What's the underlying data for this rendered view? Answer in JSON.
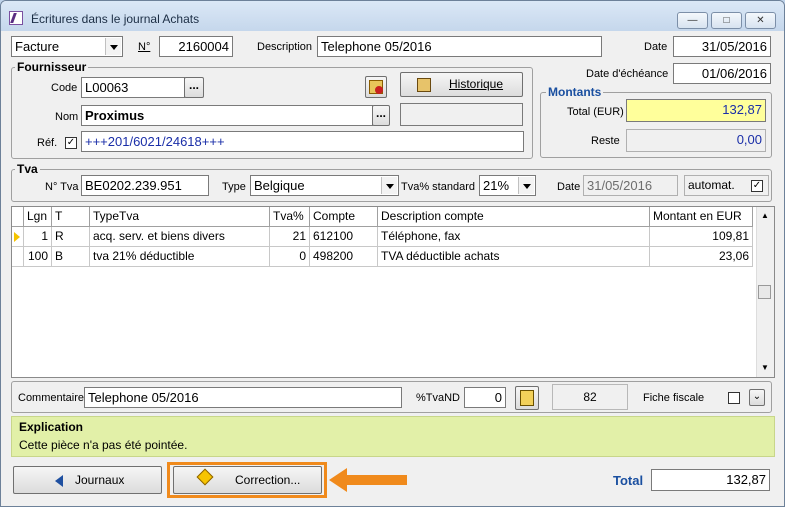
{
  "window": {
    "title": "Écritures dans le journal Achats",
    "controls": [
      "minimize-icon",
      "maximize-icon",
      "close-icon"
    ]
  },
  "header": {
    "doc_type": "Facture",
    "number_label": "N°",
    "number": "2160004",
    "description_label": "Description",
    "description": "Telephone 05/2016",
    "date_label": "Date",
    "date": "31/05/2016",
    "due_date_label": "Date d'échéance",
    "due_date": "01/06/2016"
  },
  "fournisseur": {
    "title": "Fournisseur",
    "code_label": "Code",
    "code": "L00063",
    "nom_label": "Nom",
    "nom": "Proximus",
    "ref_label": "Réf.",
    "ref_checked": true,
    "ref": "+++201/6021/24618+++",
    "history_label": "Historique",
    "ellipsis": "..."
  },
  "montants": {
    "title": "Montants",
    "total_label": "Total (EUR)",
    "total": "132,87",
    "reste_label": "Reste",
    "reste": "0,00"
  },
  "tva": {
    "title": "Tva",
    "ntva_label": "N° Tva",
    "ntva": "BE0202.239.951",
    "type_label": "Type",
    "type": "Belgique",
    "rate_label": "Tva% standard",
    "rate": "21%",
    "date_label": "Date",
    "date": "31/05/2016",
    "auto_label": "automat.",
    "auto_checked": true
  },
  "grid": {
    "columns": [
      "Lgn",
      "T",
      "TypeTva",
      "Tva%",
      "Compte",
      "Description compte",
      "Montant en EUR"
    ],
    "rows": [
      [
        "1",
        "R",
        "acq. serv. et biens divers",
        "21",
        "612100",
        "Téléphone, fax",
        "109,81"
      ],
      [
        "100",
        "B",
        "tva 21% déductible",
        "0",
        "498200",
        "TVA déductible achats",
        "23,06"
      ]
    ]
  },
  "bottom": {
    "comment_label": "Commentaire",
    "comment": "Telephone 05/2016",
    "tvand_label": "%TvaND",
    "tvand": "0",
    "count": "82",
    "fiche_label": "Fiche fiscale",
    "fiche_checked": false
  },
  "explication": {
    "title": "Explication",
    "text": "Cette pièce n'a pas été pointée."
  },
  "footer": {
    "journaux_label": "Journaux",
    "correction_label": "Correction...",
    "total_label": "Total",
    "total": "132,87"
  },
  "colors": {
    "highlight_orange": "#f08a1c",
    "total_yellow": "#ffff9b",
    "explain_green": "#e2f0a8",
    "title_blue": "#1a4fa0"
  }
}
